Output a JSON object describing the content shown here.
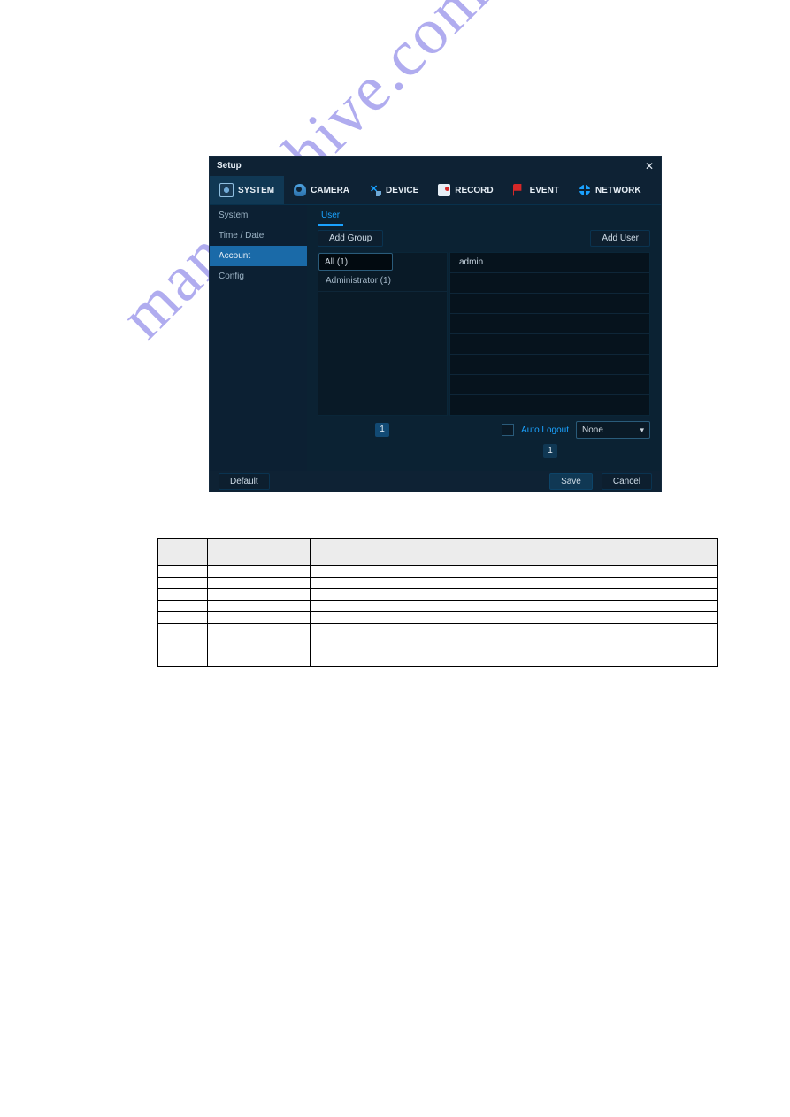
{
  "window": {
    "title": "Setup",
    "close_glyph": "✕",
    "tabs": [
      {
        "id": "system",
        "label": "SYSTEM",
        "icon": "system-icon"
      },
      {
        "id": "camera",
        "label": "CAMERA",
        "icon": "camera-icon"
      },
      {
        "id": "device",
        "label": "DEVICE",
        "icon": "device-icon"
      },
      {
        "id": "record",
        "label": "RECORD",
        "icon": "record-icon"
      },
      {
        "id": "event",
        "label": "EVENT",
        "icon": "event-icon"
      },
      {
        "id": "network",
        "label": "NETWORK",
        "icon": "network-icon"
      }
    ],
    "active_tab": "system",
    "sidebar": [
      {
        "id": "system_side",
        "label": "System"
      },
      {
        "id": "timedate_side",
        "label": "Time / Date"
      },
      {
        "id": "account_side",
        "label": "Account"
      },
      {
        "id": "config_side",
        "label": "Config"
      }
    ],
    "active_side": "account_side",
    "subtab_label": "User",
    "buttons": {
      "add_group": "Add Group",
      "add_user": "Add User",
      "default": "Default",
      "save": "Save",
      "cancel": "Cancel"
    },
    "group_list": [
      {
        "id": "all",
        "label": "All (1)",
        "selected": true
      },
      {
        "id": "admin",
        "label": "Administrator (1)",
        "selected": false
      }
    ],
    "user_list": [
      {
        "id": "admin_user",
        "label": "admin"
      }
    ],
    "group_pager": "1",
    "user_pager": "1",
    "auto_logout": {
      "label": "Auto Logout",
      "value": "None"
    }
  },
  "watermark_text": "manualshive.com",
  "desc_table": {
    "headers": [
      "",
      "",
      ""
    ],
    "rows": [
      [
        "",
        "",
        ""
      ],
      [
        "",
        "",
        ""
      ],
      [
        "",
        "",
        ""
      ],
      [
        "",
        "",
        ""
      ],
      [
        "",
        "",
        ""
      ],
      [
        "",
        "",
        ""
      ]
    ],
    "rowspan_last": 2
  }
}
